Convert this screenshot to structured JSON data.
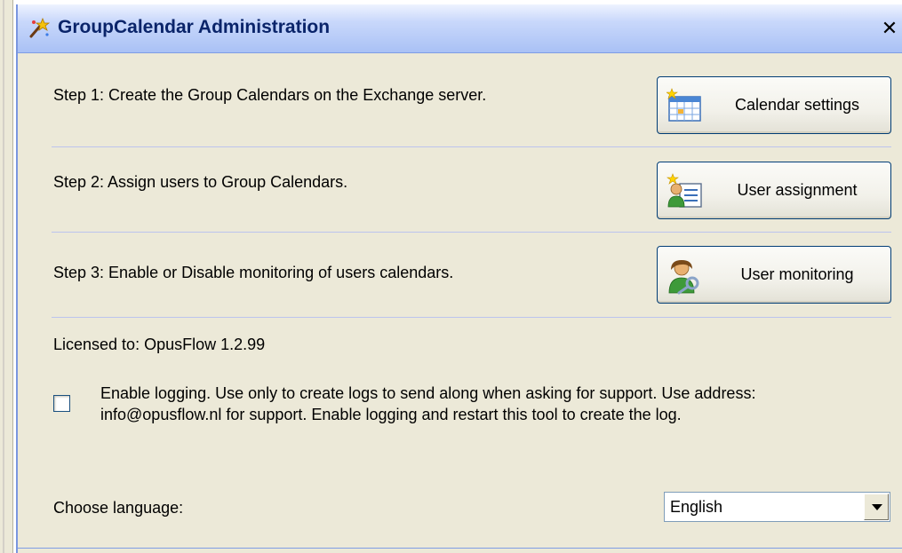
{
  "window": {
    "title": "GroupCalendar Administration",
    "close_symbol": "✕",
    "title_icon": "wizard-wand-icon"
  },
  "steps": [
    {
      "text": "Step 1: Create the Group Calendars on the Exchange server.",
      "button_label": "Calendar settings",
      "icon": "calendar-table-icon"
    },
    {
      "text": "Step 2: Assign users to Group Calendars.",
      "button_label": "User assignment",
      "icon": "user-card-icon"
    },
    {
      "text": "Step 3: Enable or Disable monitoring of users calendars.",
      "button_label": "User monitoring",
      "icon": "user-key-icon"
    }
  ],
  "license": {
    "text": "Licensed to: OpusFlow 1.2.99"
  },
  "logging": {
    "checked": false,
    "line1": "Enable logging. Use only to create logs to send along when asking for support. Use address:",
    "line2": "info@opusflow.nl for support. Enable logging and restart this tool to create the log."
  },
  "language": {
    "label": "Choose language:",
    "selected": "English"
  },
  "colors": {
    "title_text": "#0a246a",
    "button_border": "#003c74",
    "separator": "#bcc4ee",
    "dialog_bg": "#ece9d8"
  }
}
